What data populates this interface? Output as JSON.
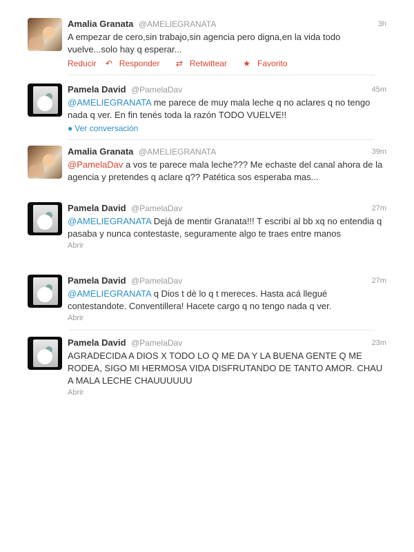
{
  "colors": {
    "mention_blue": "#2b8fc8",
    "action_red": "#d9432f",
    "meta_gray": "#999999"
  },
  "tweets": [
    {
      "name": "Amalia Granata",
      "handle": "@AMELIEGRANATA",
      "time": "3h",
      "mention": "",
      "text": "A empezar de cero,sin trabajo,sin agencia pero digna,en la vida todo vuelve...solo hay q esperar...",
      "actions": {
        "reduce": "Reducir",
        "reply": "Responder",
        "retweet": "Retwittear",
        "favorite": "Favorito"
      }
    },
    {
      "name": "Pamela David",
      "handle": "@PamelaDav",
      "time": "45m",
      "mention": "@AMELIEGRANATA",
      "text": " me parece de muy mala leche q no aclares q no tengo nada q ver. En fin tenés toda la razón TODO VUELVE!!",
      "footer": "Ver conversación"
    },
    {
      "name": "Amalia Granata",
      "handle": "@AMELIEGRANATA",
      "time": "39m",
      "mention": "@PamelaDav",
      "text": " a vos te parece mala leche??? Me echaste del canal ahora de la agencia y pretendes q aclare q?? Patética sos esperaba mas..."
    },
    {
      "name": "Pamela David",
      "handle": "@PamelaDav",
      "time": "27m",
      "mention": "@AMELIEGRANATA",
      "text": " Dejá de mentir Granata!!! T escribí al bb xq no entendia q pasaba y nunca contestaste, seguramente algo te traes entre manos",
      "footer": "Abrir"
    },
    {
      "name": "Pamela David",
      "handle": "@PamelaDav",
      "time": "27m",
      "mention": "@AMELIEGRANATA",
      "text": " q Dios t dè lo q t mereces. Hasta acá llegué contestandote. Conventillera! Hacete cargo q no tengo nada q ver.",
      "footer": "Abrir"
    },
    {
      "name": "Pamela David",
      "handle": "@PamelaDav",
      "time": "23m",
      "mention": "",
      "text": "AGRADECIDA A DIOS X TODO LO Q ME DA Y LA BUENA GENTE Q ME RODEA, SIGO MI HERMOSA VIDA DISFRUTANDO DE TANTO AMOR. CHAU A MALA LECHE CHAUUUUUU",
      "footer": "Abrir"
    }
  ]
}
